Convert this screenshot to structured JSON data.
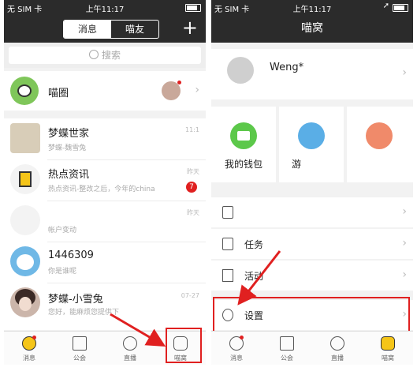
{
  "left": {
    "status": {
      "carrier": "无 SIM 卡 ",
      "time": "上午11:17"
    },
    "segments": [
      "消息",
      "喵友"
    ],
    "plus": "+",
    "search_placeholder": "搜索",
    "group": {
      "name": "喵圈"
    },
    "conversations": [
      {
        "name": "梦蝶世家",
        "preview": "梦蝶-魏雪兔",
        "time": "11:1"
      },
      {
        "name": "热点资讯",
        "preview": "热点资讯-整改之后，今年的china",
        "time": "昨天",
        "badge": "7"
      },
      {
        "name": "",
        "preview": "帐户变动",
        "time": "昨天"
      },
      {
        "name": "1446309",
        "preview": "你是谁呢",
        "time": ""
      },
      {
        "name": "梦蝶-小雪兔",
        "preview": "您好，能麻烦您提供下",
        "time": "07-27"
      }
    ],
    "tabs": [
      "消息",
      "公会",
      "直播",
      "喵窝"
    ]
  },
  "right": {
    "status": {
      "carrier": "无 SIM 卡 ",
      "time": "上午11:17"
    },
    "title": "喵窝",
    "profile_name": "Weng*",
    "cards": [
      "我的钱包",
      "游",
      ""
    ],
    "list": [
      "任务",
      "活动"
    ],
    "settings": "设置",
    "tabs": [
      "消息",
      "公会",
      "直播",
      "喵窝"
    ]
  },
  "colors": {
    "accent": "#e02020",
    "bar": "#2b2b2b",
    "wallet": "#5cc84a",
    "cat": "#f5c518"
  }
}
